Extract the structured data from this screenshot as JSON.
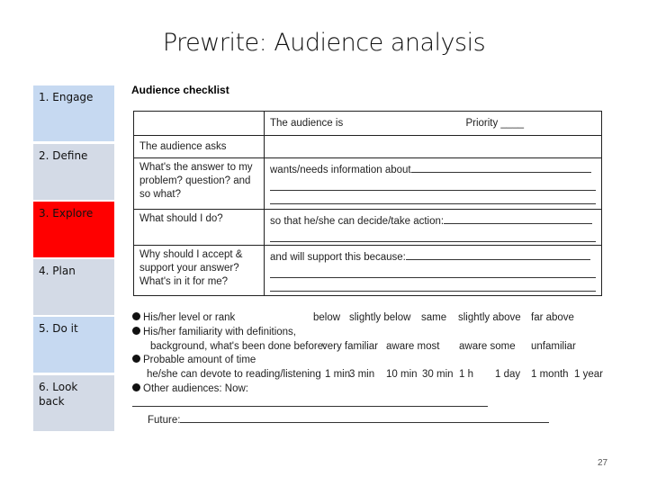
{
  "title": "Prewrite: Audience analysis",
  "steps": [
    {
      "label": "1. Engage",
      "color": "#c6d9f1"
    },
    {
      "label": "2. Define",
      "color": "#d3dae6"
    },
    {
      "label": "3. Explore",
      "color": "#ff0000",
      "active": true
    },
    {
      "label": "4. Plan",
      "color": "#d3dae6"
    },
    {
      "label": "5. Do it",
      "color": "#c6d9f1"
    },
    {
      "label": "6. Look back",
      "color": "#d3dae6"
    }
  ],
  "checklist": {
    "title": "Audience checklist",
    "header_audience": "The audience is",
    "header_priority": "Priority ____",
    "asks": "The audience asks",
    "rows": [
      {
        "q": "What's the answer to my problem? question? and so what?",
        "a": "wants/needs information about"
      },
      {
        "q": "What should I do?",
        "a": "so that he/she can decide/take action:"
      },
      {
        "q": "Why should I accept & support your answer? What's in it for me?",
        "a": "and will support this because:"
      }
    ]
  },
  "bottom": {
    "level": "His/her level or rank",
    "level_opts": [
      "below",
      "slightly below",
      "same",
      "slightly above",
      "far above"
    ],
    "familiarity": "His/her familiarity with definitions,",
    "familiarity2": "background, what's been done before:",
    "fam_opts": [
      "very familiar",
      "aware most",
      "aware some",
      "unfamiliar"
    ],
    "time": "Probable amount of time",
    "time2": "he/she can devote to reading/listening",
    "time_opts": [
      "1 min",
      "3 min",
      "10 min",
      "30 min",
      "1 h",
      "1 day",
      "1 month",
      "1 year"
    ],
    "other": "Other audiences: Now:",
    "future": "Future:"
  },
  "page_number": "27"
}
